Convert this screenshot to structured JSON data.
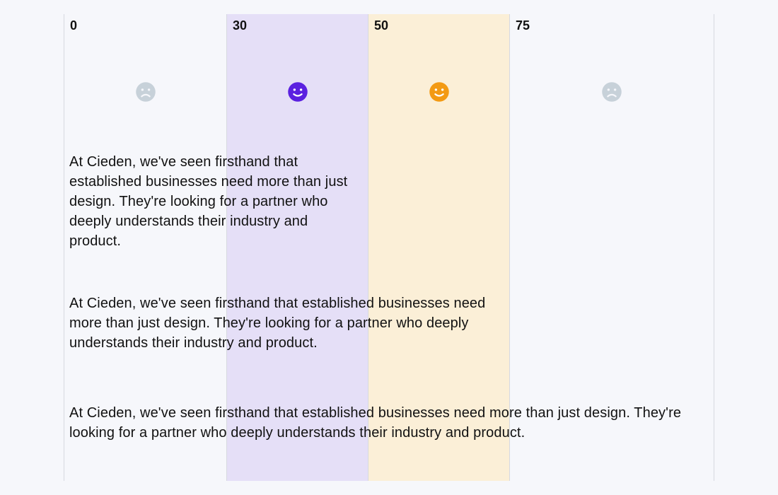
{
  "columns": [
    {
      "tick": "0",
      "mood": "sad",
      "color": "#c7d1d9"
    },
    {
      "tick": "30",
      "mood": "happy",
      "color": "#5b21e0"
    },
    {
      "tick": "50",
      "mood": "happy",
      "color": "#f39a13"
    },
    {
      "tick": "75",
      "mood": "sad",
      "color": "#c7d1d9"
    }
  ],
  "paragraphs": {
    "p1": "At Cieden, we've seen firsthand that established businesses need more than just design. They're looking for a partner who deeply understands their industry and product.",
    "p2": "At Cieden, we've seen firsthand that established businesses need more than  just design. They're looking for a partner who deeply understands their industry and product.",
    "p3": "At Cieden, we've seen firsthand that established businesses need more than  just design. They're looking for a partner who deeply understands their industry and product."
  }
}
